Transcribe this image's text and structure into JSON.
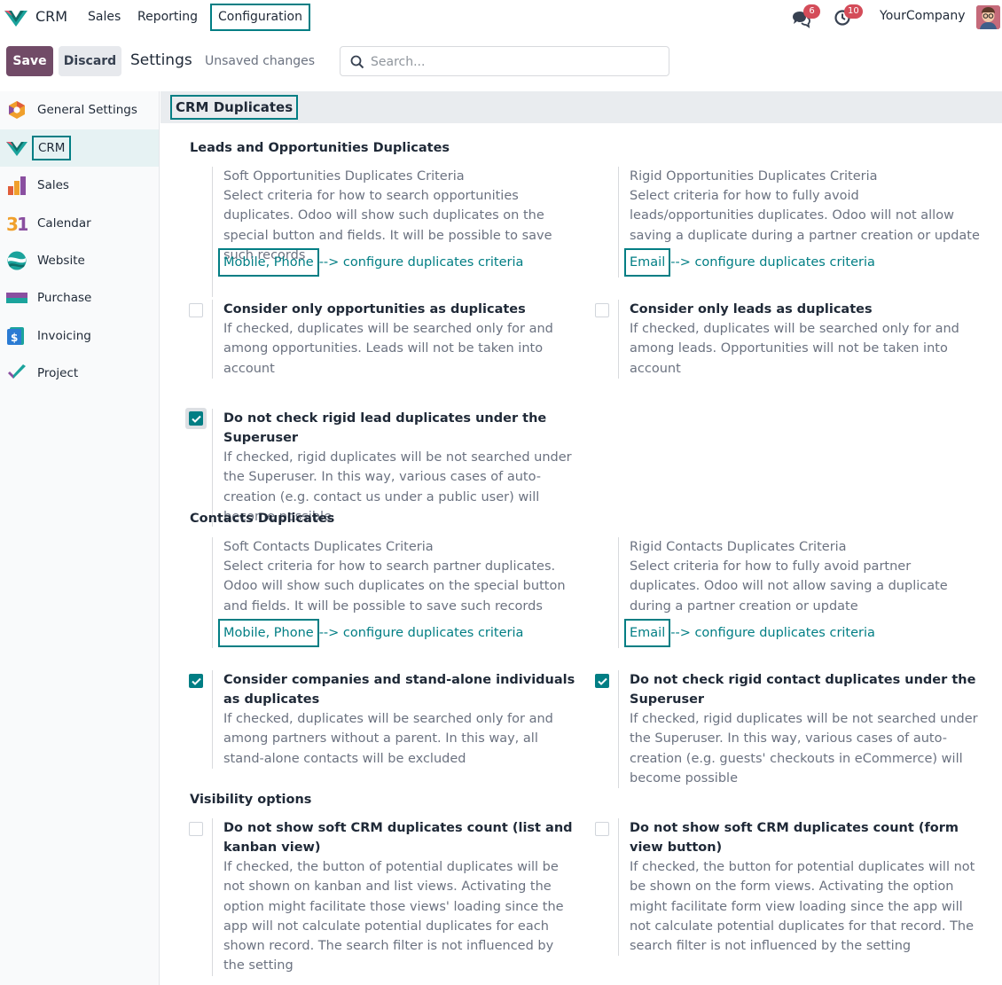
{
  "navbar": {
    "app_name": "CRM",
    "menus": [
      "Sales",
      "Reporting",
      "Configuration"
    ],
    "messages_count": "6",
    "activities_count": "10",
    "company": "YourCompany"
  },
  "control_panel": {
    "save_label": "Save",
    "discard_label": "Discard",
    "breadcrumb": "Settings",
    "status": "Unsaved changes",
    "search_placeholder": "Search..."
  },
  "sidebar": {
    "items": [
      {
        "label": "General Settings",
        "icon": "general-settings-icon"
      },
      {
        "label": "CRM",
        "icon": "crm-icon"
      },
      {
        "label": "Sales",
        "icon": "sales-icon"
      },
      {
        "label": "Calendar",
        "icon": "calendar-icon"
      },
      {
        "label": "Website",
        "icon": "website-icon"
      },
      {
        "label": "Purchase",
        "icon": "purchase-icon"
      },
      {
        "label": "Invoicing",
        "icon": "invoicing-icon"
      },
      {
        "label": "Project",
        "icon": "project-icon"
      }
    ]
  },
  "content": {
    "section_title": "CRM Duplicates",
    "leads_group": {
      "title": "Leads and Opportunities Duplicates",
      "soft": {
        "label": "Soft Opportunities Duplicates Criteria",
        "desc": "Select criteria for how to search opportunities duplicates. Odoo will show such duplicates on the special button and fields. It will be possible to save such records",
        "field": "Mobile, Phone",
        "link": "--> configure duplicates criteria"
      },
      "rigid": {
        "label": "Rigid Opportunities Duplicates Criteria",
        "desc": "Select criteria for how to fully avoid leads/opportunities duplicates. Odoo will not allow saving a duplicate during a partner creation or update",
        "field": "Email",
        "link": "--> configure duplicates criteria"
      },
      "only_opps": {
        "label": "Consider only opportunities as duplicates",
        "desc": "If checked, duplicates will be searched only for and among opportunities. Leads will not be taken into account",
        "checked": false
      },
      "only_leads": {
        "label": "Consider only leads as duplicates",
        "desc": "If checked, duplicates will be searched only for and among leads. Opportunities will not be taken into account",
        "checked": false
      },
      "superuser": {
        "label": "Do not check rigid lead duplicates under the Superuser",
        "desc": "If checked, rigid duplicates will be not searched under the Superuser. In this way, various cases of auto-creation (e.g. contact us under a public user) will become possible",
        "checked": true
      }
    },
    "contacts_group": {
      "title": "Contacts Duplicates",
      "soft": {
        "label": "Soft Contacts Duplicates Criteria",
        "desc": "Select criteria for how to search partner duplicates. Odoo will show such duplicates on the special button and fields. It will be possible to save such records",
        "field": "Mobile, Phone",
        "link": "--> configure duplicates criteria"
      },
      "rigid": {
        "label": "Rigid Contacts Duplicates Criteria",
        "desc": "Select criteria for how to fully avoid partner duplicates. Odoo will not allow saving a duplicate during a partner creation or update",
        "field": "Email",
        "link": "--> configure duplicates criteria"
      },
      "companies": {
        "label": "Consider companies and stand-alone individuals as duplicates",
        "desc": "If checked, duplicates will be searched only for and among partners without a parent. In this way, all stand-alone contacts will be excluded",
        "checked": true
      },
      "superuser": {
        "label": "Do not check rigid contact duplicates under the Superuser",
        "desc": "If checked, rigid duplicates will be not searched under the Superuser. In this way, various cases of auto-creation (e.g. guests' checkouts in eCommerce) will become possible",
        "checked": true
      }
    },
    "visibility_group": {
      "title": "Visibility options",
      "list_kanban": {
        "label": "Do not show soft CRM duplicates count (list and kanban view)",
        "desc": "If checked, the button of potential duplicates will be not shown on kanban and list views. Activating the option might facilitate those views' loading since the app will not calculate potential duplicates for each shown record. The search filter is not influenced by the setting",
        "checked": false
      },
      "form_view": {
        "label": "Do not show soft CRM duplicates count (form view button)",
        "desc": "If checked, the button for potential duplicates will not be shown on the form views. Activating the option might facilitate form view loading since the app will not calculate potential duplicates for that record. The search filter is not influenced by the setting",
        "checked": false
      }
    }
  },
  "colors": {
    "primary": "#714b67",
    "accent": "#017e84",
    "badge": "#d44c59"
  }
}
